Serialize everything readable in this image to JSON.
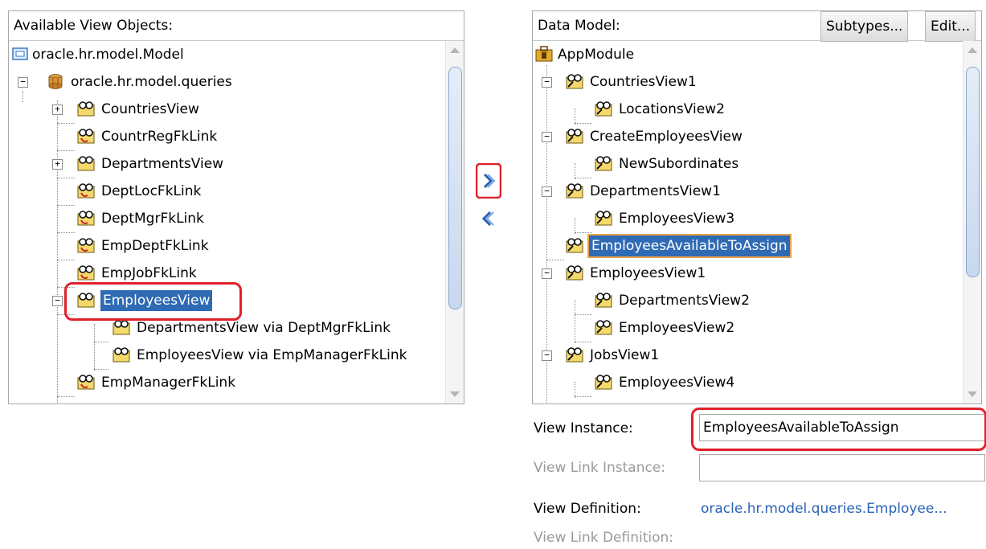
{
  "left_panel": {
    "title": "Available View Objects:",
    "items": [
      {
        "label": "oracle.hr.model.Model"
      },
      {
        "label": "oracle.hr.model.queries"
      },
      {
        "label": "CountriesView"
      },
      {
        "label": "CountrRegFkLink"
      },
      {
        "label": "DepartmentsView"
      },
      {
        "label": "DeptLocFkLink"
      },
      {
        "label": "DeptMgrFkLink"
      },
      {
        "label": "EmpDeptFkLink"
      },
      {
        "label": "EmpJobFkLink"
      },
      {
        "label": "EmployeesView"
      },
      {
        "label": "DepartmentsView via DeptMgrFkLink"
      },
      {
        "label": "EmployeesView via EmpManagerFkLink"
      },
      {
        "label": "EmpManagerFkLink"
      }
    ]
  },
  "shuttle": {
    "add_icon": "chevron-right-icon",
    "remove_icon": "chevron-left-icon"
  },
  "right_panel": {
    "title": "Data Model:",
    "subtypes_label": "Subtypes...",
    "edit_label": "Edit...",
    "items": [
      {
        "label": "AppModule"
      },
      {
        "label": "CountriesView1"
      },
      {
        "label": "LocationsView2"
      },
      {
        "label": "CreateEmployeesView"
      },
      {
        "label": "NewSubordinates"
      },
      {
        "label": "DepartmentsView1"
      },
      {
        "label": "EmployeesView3"
      },
      {
        "label": "EmployeesAvailableToAssign"
      },
      {
        "label": "EmployeesView1"
      },
      {
        "label": "DepartmentsView2"
      },
      {
        "label": "EmployeesView2"
      },
      {
        "label": "JobsView1"
      },
      {
        "label": "EmployeesView4"
      }
    ]
  },
  "form": {
    "view_instance_label": "View Instance:",
    "view_instance_value": "EmployeesAvailableToAssign",
    "view_link_instance_label": "View Link Instance:",
    "view_link_instance_value": "",
    "view_definition_label": "View Definition:",
    "view_definition_value": "oracle.hr.model.queries.Employee...",
    "view_link_definition_label": "View Link Definition:"
  },
  "colors": {
    "selection": "#2f6ab4",
    "highlight": "#e0202a",
    "link": "#2a62b8"
  }
}
